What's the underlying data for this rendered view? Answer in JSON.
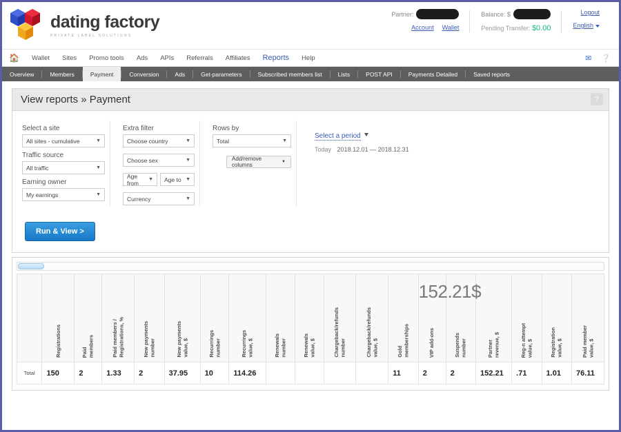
{
  "brand": {
    "name": "dating factory",
    "tagline": "PRIVATE LABEL SOLUTIONS"
  },
  "header": {
    "partner_label": "Partner:",
    "partner_value_redacted": true,
    "account_link": "Account",
    "wallet_link": "Wallet",
    "balance_label": "Balance: $",
    "balance_value_redacted": true,
    "pending_label": "Pending Transfer:",
    "pending_value": "$0.00",
    "logout_link": "Logout",
    "language": "English",
    "mail_icon": "envelope-icon",
    "help_icon": "question-circle-icon"
  },
  "mainnav": {
    "home_icon": "home-icon",
    "items": [
      {
        "label": "Wallet",
        "active": false
      },
      {
        "label": "Sites",
        "active": false
      },
      {
        "label": "Promo tools",
        "active": false
      },
      {
        "label": "Ads",
        "active": false
      },
      {
        "label": "APIs",
        "active": false
      },
      {
        "label": "Referrals",
        "active": false
      },
      {
        "label": "Affiliates",
        "active": false
      },
      {
        "label": "Reports",
        "active": true
      },
      {
        "label": "Help",
        "active": false
      }
    ]
  },
  "subnav": {
    "items": [
      {
        "label": "Overview",
        "active": false
      },
      {
        "label": "Members",
        "active": false
      },
      {
        "label": "Payment",
        "active": true
      },
      {
        "label": "Conversion",
        "active": false
      },
      {
        "label": "Ads",
        "active": false
      },
      {
        "label": "Get-parameters",
        "active": false
      },
      {
        "label": "Subscribed members list",
        "active": false
      },
      {
        "label": "Lists",
        "active": false
      },
      {
        "label": "POST API",
        "active": false
      },
      {
        "label": "Payments Detailed",
        "active": false
      },
      {
        "label": "Saved reports",
        "active": false
      }
    ]
  },
  "page": {
    "title": "View reports » Payment",
    "help_button": "?"
  },
  "filters": {
    "site": {
      "label": "Select a site",
      "value": "All sites - cumulative"
    },
    "traffic": {
      "label": "Traffic source",
      "value": "All traffic"
    },
    "earning": {
      "label": "Earning owner",
      "value": "My earnings"
    },
    "extra_label": "Extra filter",
    "country": {
      "value": "Choose country"
    },
    "sex": {
      "value": "Choose sex"
    },
    "age_from": {
      "value": "Age from"
    },
    "age_to": {
      "value": "Age to"
    },
    "currency": {
      "value": "Currency"
    },
    "rows_by": {
      "label": "Rows by",
      "value": "Total"
    },
    "add_remove_columns": "Add/remove columns",
    "period_link": "Select a period",
    "period_today": "Today",
    "period_range": "2018.12.01 — 2018.12.31",
    "run_button": "Run & View >"
  },
  "report": {
    "highlight_figure": "152.21$",
    "columns": [
      "",
      "Registrations",
      "Paid\nmembers",
      "Paid members /\nRegistrations, %",
      "New payments\nnumber",
      "New payments\nvalue, $",
      "Recurrings\nnumber",
      "Recurrings\nvalue, $",
      "Renewals\nnumber",
      "Renewals\nvalue, $",
      "Chargeback/refunds\nnumber",
      "Chargeback/refunds\nvalue, $",
      "Gold\nmemberships",
      "VIP add-ons",
      "Suspends\nnumber",
      "Partner\nrevenue, $",
      "Reg-n attempt\nvalue, $",
      "Registration\nvalue, $",
      "Paid member\nvalue, $"
    ],
    "rows": [
      {
        "label": "Total",
        "cells": [
          "150",
          "2",
          "1.33",
          "2",
          "37.95",
          "10",
          "114.26",
          "",
          "",
          "",
          "",
          "11",
          "2",
          "2",
          "152.21",
          ".71",
          "1.01",
          "76.11"
        ]
      }
    ]
  }
}
